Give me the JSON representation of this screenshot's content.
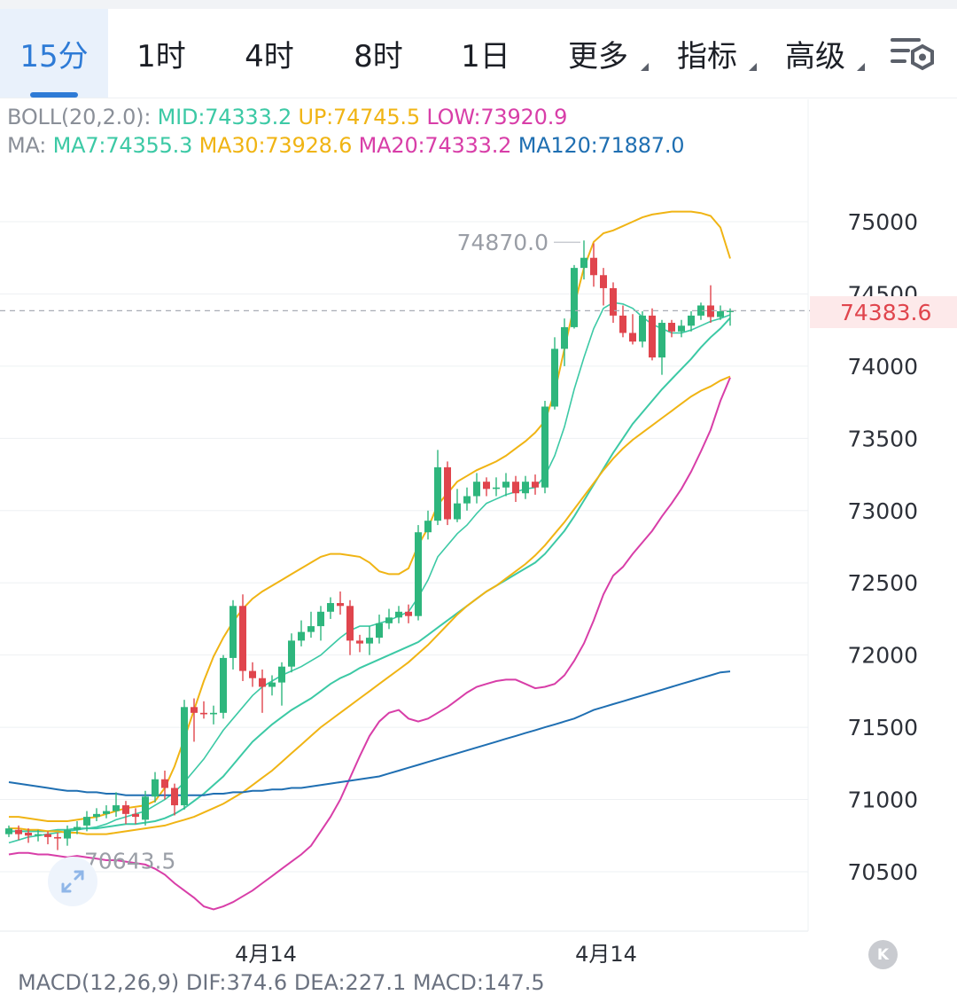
{
  "tabs": [
    {
      "label": "15分",
      "active": true,
      "dropdown": false
    },
    {
      "label": "1时",
      "active": false,
      "dropdown": false
    },
    {
      "label": "4时",
      "active": false,
      "dropdown": false
    },
    {
      "label": "8时",
      "active": false,
      "dropdown": false
    },
    {
      "label": "1日",
      "active": false,
      "dropdown": false
    },
    {
      "label": "更多",
      "active": false,
      "dropdown": true
    },
    {
      "label": "指标",
      "active": false,
      "dropdown": true
    },
    {
      "label": "高级",
      "active": false,
      "dropdown": true
    }
  ],
  "settings_icon": "chart-settings-icon",
  "boll": {
    "prefix": "BOLL(20,2.0):",
    "mid": "MID:74333.2",
    "up": "UP:74745.5",
    "low": "LOW:73920.9"
  },
  "ma": {
    "prefix": "MA:",
    "ma7": "MA7:74355.3",
    "ma30": "MA30:73928.6",
    "ma20": "MA20:74333.2",
    "ma120": "MA120:71887.0"
  },
  "current_price": "74383.6",
  "high_marker": "74870.0",
  "low_marker": "70643.5",
  "macd_partial": "MACD(12,26,9) DIF:374.6 DEA:227.1 MACD:147.5",
  "k_button": "K",
  "colors": {
    "up": "#2eb67d",
    "down": "#e0454d",
    "mid": "#3cc9a5",
    "upper": "#f0b414",
    "lower": "#d83ea8",
    "ma120": "#1f6fb2",
    "accent": "#2e7bd6"
  },
  "chart_data": {
    "type": "candlestick",
    "ylim": [
      70200,
      75300
    ],
    "y_ticks": [
      75000,
      74500,
      74000,
      73500,
      73000,
      72500,
      72000,
      71500,
      71000,
      70500
    ],
    "x_labels": [
      "4月14",
      "4月14"
    ],
    "current_price": 74383.6,
    "high": 74870.0,
    "low": 70643.5,
    "candles": [
      [
        70760,
        70800,
        70740,
        70820
      ],
      [
        70790,
        70760,
        70720,
        70820
      ],
      [
        70770,
        70750,
        70700,
        70800
      ],
      [
        70750,
        70760,
        70710,
        70790
      ],
      [
        70760,
        70740,
        70690,
        70780
      ],
      [
        70740,
        70730,
        70650,
        70770
      ],
      [
        70730,
        70790,
        70680,
        70820
      ],
      [
        70790,
        70810,
        70760,
        70850
      ],
      [
        70820,
        70880,
        70780,
        70920
      ],
      [
        70880,
        70900,
        70850,
        70940
      ],
      [
        70900,
        70920,
        70870,
        70960
      ],
      [
        70920,
        70960,
        70880,
        71050
      ],
      [
        70960,
        70900,
        70830,
        70990
      ],
      [
        70900,
        70880,
        70830,
        70940
      ],
      [
        70860,
        71020,
        70820,
        71060
      ],
      [
        71020,
        71140,
        70980,
        71190
      ],
      [
        71140,
        71080,
        71000,
        71200
      ],
      [
        71080,
        70960,
        70890,
        71110
      ],
      [
        70960,
        71640,
        70930,
        71690
      ],
      [
        71640,
        71600,
        71400,
        71700
      ],
      [
        71600,
        71590,
        71560,
        71680
      ],
      [
        71590,
        71600,
        71520,
        71650
      ],
      [
        71600,
        71980,
        71560,
        72000
      ],
      [
        71980,
        72340,
        71900,
        72380
      ],
      [
        72340,
        71890,
        71820,
        72420
      ],
      [
        71890,
        71840,
        71780,
        71950
      ],
      [
        71840,
        71780,
        71600,
        71900
      ],
      [
        71780,
        71810,
        71720,
        71860
      ],
      [
        71810,
        71920,
        71650,
        71950
      ],
      [
        71920,
        72100,
        71880,
        72150
      ],
      [
        72100,
        72160,
        72060,
        72240
      ],
      [
        72160,
        72200,
        72120,
        72300
      ],
      [
        72200,
        72300,
        72100,
        72340
      ],
      [
        72300,
        72360,
        72250,
        72400
      ],
      [
        72360,
        72340,
        72280,
        72440
      ],
      [
        72340,
        72100,
        72000,
        72380
      ],
      [
        72100,
        72080,
        72020,
        72140
      ],
      [
        72080,
        72120,
        72000,
        72200
      ],
      [
        72120,
        72220,
        72080,
        72280
      ],
      [
        72220,
        72260,
        72180,
        72320
      ],
      [
        72260,
        72300,
        72220,
        72340
      ],
      [
        72300,
        72270,
        72220,
        72350
      ],
      [
        72270,
        72850,
        72240,
        72900
      ],
      [
        72850,
        72930,
        72800,
        73000
      ],
      [
        72930,
        73300,
        72900,
        73420
      ],
      [
        73300,
        72940,
        72900,
        73340
      ],
      [
        72940,
        73050,
        72920,
        73150
      ],
      [
        73050,
        73100,
        73000,
        73160
      ],
      [
        73100,
        73200,
        73050,
        73260
      ],
      [
        73200,
        73150,
        73100,
        73230
      ],
      [
        73150,
        73160,
        73100,
        73230
      ],
      [
        73160,
        73200,
        73100,
        73260
      ],
      [
        73200,
        73120,
        73060,
        73240
      ],
      [
        73120,
        73200,
        73080,
        73240
      ],
      [
        73200,
        73160,
        73110,
        73250
      ],
      [
        73160,
        73720,
        73120,
        73760
      ],
      [
        73720,
        74120,
        73700,
        74200
      ],
      [
        74120,
        74270,
        74000,
        74330
      ],
      [
        74270,
        74680,
        74260,
        74700
      ],
      [
        74680,
        74750,
        74600,
        74870
      ],
      [
        74750,
        74630,
        74550,
        74850
      ],
      [
        74630,
        74540,
        74420,
        74680
      ],
      [
        74540,
        74350,
        74300,
        74580
      ],
      [
        74350,
        74230,
        74200,
        74420
      ],
      [
        74230,
        74170,
        74150,
        74360
      ],
      [
        74170,
        74350,
        74130,
        74380
      ],
      [
        74350,
        74060,
        74040,
        74400
      ],
      [
        74060,
        74300,
        73940,
        74320
      ],
      [
        74300,
        74240,
        74200,
        74320
      ],
      [
        74240,
        74280,
        74200,
        74320
      ],
      [
        74280,
        74350,
        74240,
        74380
      ],
      [
        74350,
        74420,
        74320,
        74440
      ],
      [
        74420,
        74340,
        74300,
        74560
      ],
      [
        74340,
        74380,
        74320,
        74420
      ],
      [
        74380,
        74383.6,
        74280,
        74400
      ]
    ],
    "series": [
      {
        "name": "MID",
        "values": [
          70780,
          70780,
          70780,
          70780,
          70780,
          70790,
          70790,
          70800,
          70800,
          70800,
          70810,
          70820,
          70830,
          70830,
          70840,
          70850,
          70870,
          70900,
          70940,
          70990,
          71040,
          71100,
          71160,
          71240,
          71320,
          71400,
          71460,
          71520,
          71570,
          71620,
          71660,
          71700,
          71750,
          71800,
          71840,
          71870,
          71910,
          71940,
          71970,
          72000,
          72030,
          72060,
          72090,
          72140,
          72190,
          72240,
          72290,
          72340,
          72390,
          72440,
          72480,
          72520,
          72560,
          72600,
          72640,
          72700,
          72780,
          72860,
          72960,
          73070,
          73180,
          73290,
          73400,
          73500,
          73600,
          73680,
          73760,
          73840,
          73910,
          73980,
          74050,
          74130,
          74200,
          74260,
          74333.2
        ]
      },
      {
        "name": "UP",
        "values": [
          70880,
          70880,
          70870,
          70860,
          70850,
          70850,
          70850,
          70860,
          70870,
          70880,
          70900,
          70920,
          70940,
          70950,
          70960,
          70990,
          71080,
          71230,
          71420,
          71620,
          71820,
          71990,
          72120,
          72230,
          72320,
          72390,
          72440,
          72480,
          72520,
          72560,
          72600,
          72640,
          72680,
          72700,
          72700,
          72690,
          72680,
          72640,
          72580,
          72560,
          72560,
          72600,
          72760,
          72880,
          73040,
          73120,
          73200,
          73240,
          73280,
          73310,
          73340,
          73380,
          73430,
          73480,
          73540,
          73620,
          73820,
          74120,
          74420,
          74680,
          74860,
          74920,
          74940,
          74970,
          75000,
          75030,
          75050,
          75060,
          75070,
          75070,
          75070,
          75060,
          75040,
          74960,
          74745.5
        ]
      },
      {
        "name": "LOW",
        "values": [
          70620,
          70630,
          70630,
          70620,
          70620,
          70610,
          70600,
          70610,
          70600,
          70590,
          70580,
          70580,
          70570,
          70560,
          70550,
          70520,
          70480,
          70420,
          70370,
          70320,
          70260,
          70240,
          70260,
          70290,
          70330,
          70370,
          70420,
          70470,
          70520,
          70570,
          70620,
          70680,
          70780,
          70880,
          71000,
          71150,
          71300,
          71440,
          71540,
          71600,
          71620,
          71560,
          71540,
          71560,
          71600,
          71640,
          71690,
          71740,
          71780,
          71800,
          71820,
          71830,
          71830,
          71800,
          71770,
          71780,
          71800,
          71860,
          71960,
          72080,
          72240,
          72420,
          72550,
          72610,
          72700,
          72780,
          72860,
          72960,
          73050,
          73150,
          73270,
          73410,
          73560,
          73760,
          73920.9
        ]
      },
      {
        "name": "MA7",
        "values": [
          70700,
          70720,
          70740,
          70750,
          70760,
          70770,
          70780,
          70790,
          70800,
          70810,
          70830,
          70860,
          70880,
          70900,
          70920,
          70960,
          71000,
          71050,
          71120,
          71200,
          71280,
          71380,
          71480,
          71560,
          71640,
          71720,
          71780,
          71820,
          71860,
          71890,
          71920,
          71960,
          72000,
          72060,
          72120,
          72170,
          72200,
          72200,
          72220,
          72240,
          72270,
          72300,
          72400,
          72520,
          72680,
          72760,
          72840,
          72900,
          72980,
          73050,
          73080,
          73110,
          73130,
          73150,
          73160,
          73240,
          73380,
          73580,
          73840,
          74060,
          74260,
          74400,
          74440,
          74430,
          74400,
          74340,
          74290,
          74260,
          74230,
          74230,
          74250,
          74280,
          74310,
          74330,
          74355.3
        ]
      },
      {
        "name": "MA30",
        "values": [
          70800,
          70800,
          70790,
          70790,
          70780,
          70780,
          70770,
          70770,
          70760,
          70760,
          70760,
          70770,
          70780,
          70790,
          70800,
          70810,
          70820,
          70840,
          70860,
          70880,
          70910,
          70940,
          70970,
          71010,
          71050,
          71100,
          71150,
          71200,
          71260,
          71320,
          71380,
          71440,
          71500,
          71550,
          71600,
          71650,
          71700,
          71750,
          71800,
          71850,
          71900,
          71950,
          72010,
          72070,
          72140,
          72210,
          72280,
          72340,
          72390,
          72440,
          72480,
          72530,
          72580,
          72630,
          72690,
          72760,
          72840,
          72920,
          73010,
          73100,
          73190,
          73280,
          73360,
          73430,
          73490,
          73540,
          73590,
          73640,
          73690,
          73740,
          73790,
          73830,
          73860,
          73900,
          73928.6
        ]
      },
      {
        "name": "MA120",
        "values": [
          71120,
          71110,
          71100,
          71090,
          71080,
          71070,
          71060,
          71060,
          71050,
          71050,
          71040,
          71040,
          71030,
          71030,
          71030,
          71030,
          71030,
          71030,
          71030,
          71030,
          71030,
          71040,
          71040,
          71050,
          71050,
          71060,
          71060,
          71070,
          71070,
          71080,
          71080,
          71090,
          71100,
          71110,
          71120,
          71130,
          71140,
          71150,
          71160,
          71180,
          71200,
          71220,
          71240,
          71260,
          71280,
          71300,
          71320,
          71340,
          71360,
          71380,
          71400,
          71420,
          71440,
          71460,
          71480,
          71500,
          71520,
          71540,
          71560,
          71590,
          71620,
          71640,
          71660,
          71680,
          71700,
          71720,
          71740,
          71760,
          71780,
          71800,
          71820,
          71840,
          71860,
          71880,
          71887.0
        ]
      }
    ]
  }
}
